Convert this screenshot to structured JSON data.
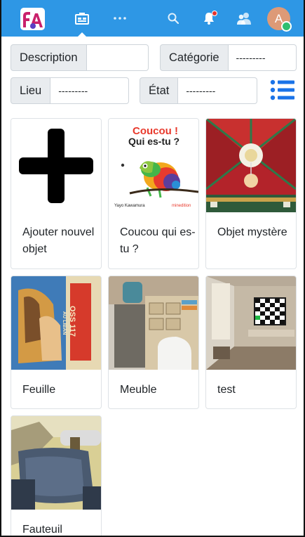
{
  "navbar": {
    "logo_text": "fa",
    "icons": [
      "inventory-icon",
      "more-icon",
      "search-icon",
      "bell-icon",
      "users-icon"
    ],
    "avatar_letter": "A",
    "colors": {
      "bar": "#2e97e5",
      "avatar": "#dd9a77",
      "status": "#2fbf71",
      "notification": "#e3342f"
    }
  },
  "filters": {
    "description": {
      "label": "Description",
      "value": ""
    },
    "categorie": {
      "label": "Catégorie",
      "value": "---------"
    },
    "lieu": {
      "label": "Lieu",
      "value": "---------"
    },
    "etat": {
      "label": "État",
      "value": "---------"
    }
  },
  "view_toggle": {
    "icon": "list-icon",
    "color": "#1a73e8"
  },
  "cards": [
    {
      "title": "Ajouter nouvel objet",
      "image": "plus-icon"
    },
    {
      "title": "Coucou qui es-tu ?",
      "image": "book-cover",
      "cover_title_line1": "Coucou !",
      "cover_title_line2": "Qui es-tu ?",
      "cover_author": "Yayo Kawamura",
      "cover_publisher": "minedition"
    },
    {
      "title": "Objet mystère",
      "image": "ceiling-photo"
    },
    {
      "title": "Feuille",
      "image": "poster-photo",
      "poster_text_1": "OSS 117",
      "poster_text_2": "AU LIBAN"
    },
    {
      "title": "Meuble",
      "image": "furniture-photo"
    },
    {
      "title": "test",
      "image": "room-photo"
    },
    {
      "title": "Fauteuil",
      "image": "chair-photo"
    }
  ]
}
